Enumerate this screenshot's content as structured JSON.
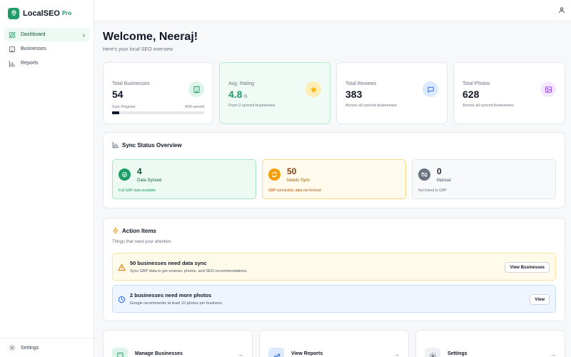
{
  "app": {
    "name": "LocalSEO",
    "badge": "Pro",
    "brand_color": "#1f9d67"
  },
  "sidebar": {
    "items": [
      {
        "label": "Dashboard",
        "icon": "dashboard-icon",
        "active": true
      },
      {
        "label": "Businesses",
        "icon": "building-icon",
        "active": false
      },
      {
        "label": "Reports",
        "icon": "bar-chart-icon",
        "active": false
      }
    ],
    "footer": {
      "label": "Settings",
      "icon": "gear-icon"
    }
  },
  "header": {
    "title": "Welcome, Neeraj!",
    "subtitle": "Here's your local SEO overview",
    "user_icon": "user-icon"
  },
  "stats": [
    {
      "label": "Total Businesses",
      "value": "54",
      "sync_label": "Sync Progress",
      "sync_value": "4/54 synced",
      "progress": 0.074,
      "icon": "building-icon"
    },
    {
      "label": "Avg. Rating",
      "value": "4.8",
      "suffix": "/5",
      "note": "From 2 synced businesses",
      "icon": "star-icon"
    },
    {
      "label": "Total Reviews",
      "value": "383",
      "note": "Across all synced businesses",
      "icon": "message-icon"
    },
    {
      "label": "Total Photos",
      "value": "628",
      "note": "Across all synced businesses",
      "icon": "image-icon"
    }
  ],
  "sync_overview": {
    "title": "Sync Status Overview",
    "cards": [
      {
        "count": "4",
        "label": "Data Synced",
        "desc": "Full GBP data available",
        "status": "success",
        "icon": "check-icon",
        "color": "#1f9d67"
      },
      {
        "count": "50",
        "label": "Needs Sync",
        "desc": "GBP connected, data not fetched",
        "status": "warning",
        "icon": "refresh-icon",
        "color": "#f59e0b"
      },
      {
        "count": "0",
        "label": "Manual",
        "desc": "Not linked to GBP",
        "status": "neutral",
        "icon": "unlink-icon",
        "color": "#6b7280"
      }
    ]
  },
  "action_items": {
    "title": "Action Items",
    "subtitle": "Things that need your attention",
    "items": [
      {
        "title": "50 businesses need data sync",
        "desc": "Sync GBP data to get reviews, photos, and SEO recommendations.",
        "button": "View Businesses",
        "tone": "warning",
        "icon": "warning-icon"
      },
      {
        "title": "2 businesses need more photos",
        "desc": "Google recommends at least 10 photos per business.",
        "button": "View",
        "tone": "info",
        "icon": "clock-icon"
      }
    ]
  },
  "quick_actions": [
    {
      "label": "Manage Businesses",
      "icon": "building-icon"
    },
    {
      "label": "View Reports",
      "icon": "trend-icon"
    },
    {
      "label": "Settings",
      "icon": "gear-icon"
    }
  ]
}
